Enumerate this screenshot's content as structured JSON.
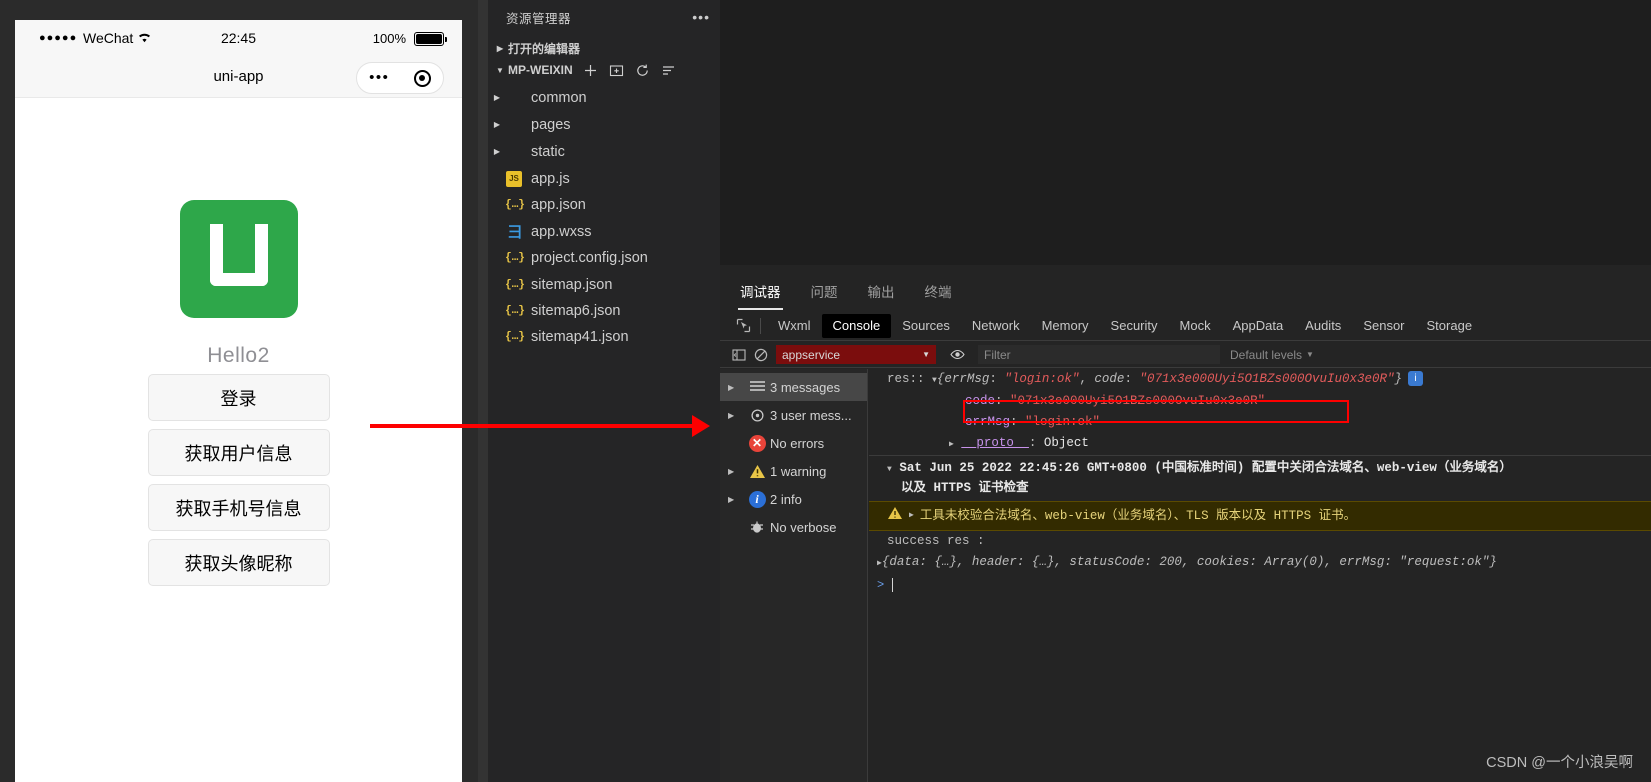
{
  "simulator": {
    "status_bar": {
      "signal_dots": "●●●●●",
      "carrier": "WeChat",
      "wifi_icon": "wifi-icon",
      "time": "22:45",
      "battery_percent": "100%",
      "battery_icon": "battery-full-icon"
    },
    "nav": {
      "title": "uni-app",
      "capsule_more_icon": "•••",
      "capsule_target_icon": "target-icon"
    },
    "app": {
      "logo_icon": "uni-app-logo-icon",
      "logo_color": "#2eA74A",
      "heading": "Hello2",
      "buttons": [
        "登录",
        "获取用户信息",
        "获取手机号信息",
        "获取头像昵称"
      ]
    }
  },
  "explorer": {
    "title": "资源管理器",
    "more_icon": "•••",
    "sections": [
      {
        "label": "打开的编辑器",
        "twisty": "collapsed"
      },
      {
        "label": "MP-WEIXIN",
        "twisty": "expanded"
      }
    ],
    "section_actions": [
      "new-file-icon",
      "new-folder-icon",
      "refresh-icon",
      "collapse-all-icon"
    ],
    "tree": [
      {
        "label": "common",
        "kind": "folder",
        "color": "#6b7a8b",
        "twisty": "collapsed"
      },
      {
        "label": "pages",
        "kind": "folder",
        "color": "#f06a3f",
        "twisty": "collapsed"
      },
      {
        "label": "static",
        "kind": "folder",
        "color": "#e8b62c",
        "twisty": "collapsed"
      },
      {
        "label": "app.js",
        "kind": "js",
        "color": "#e9c02a",
        "tag": "JS"
      },
      {
        "label": "app.json",
        "kind": "json",
        "color": "#e8c547",
        "tag": "{…}"
      },
      {
        "label": "app.wxss",
        "kind": "css",
        "color": "#3b9ae1",
        "tag": "彐"
      },
      {
        "label": "project.config.json",
        "kind": "json",
        "color": "#e8c547",
        "tag": "{…}"
      },
      {
        "label": "sitemap.json",
        "kind": "json",
        "color": "#e8c547",
        "tag": "{…}"
      },
      {
        "label": "sitemap6.json",
        "kind": "json",
        "color": "#e8c547",
        "tag": "{…}"
      },
      {
        "label": "sitemap41.json",
        "kind": "json",
        "color": "#e8c547",
        "tag": "{…}"
      }
    ]
  },
  "devtools": {
    "outer_tabs": [
      {
        "label": "调试器",
        "active": true
      },
      {
        "label": "问题",
        "active": false
      },
      {
        "label": "输出",
        "active": false
      },
      {
        "label": "终端",
        "active": false
      }
    ],
    "inspect_icon": "inspect-element-icon",
    "panel_tabs": [
      {
        "label": "Wxml",
        "active": false
      },
      {
        "label": "Console",
        "active": true
      },
      {
        "label": "Sources",
        "active": false
      },
      {
        "label": "Network",
        "active": false
      },
      {
        "label": "Memory",
        "active": false
      },
      {
        "label": "Security",
        "active": false
      },
      {
        "label": "Mock",
        "active": false
      },
      {
        "label": "AppData",
        "active": false
      },
      {
        "label": "Audits",
        "active": false
      },
      {
        "label": "Sensor",
        "active": false
      },
      {
        "label": "Storage",
        "active": false
      }
    ],
    "console_toolbar": {
      "sidebar_toggle_icon": "console-sidebar-icon",
      "clear_icon": "clear-console-icon",
      "context_value": "appservice",
      "context_bg": "#7b0d0d",
      "eye_icon": "live-expression-icon",
      "filter_placeholder": "Filter",
      "levels_label": "Default levels"
    },
    "counts_sidebar": [
      {
        "label": "3 messages",
        "icon": "list-icon",
        "twisty": true,
        "selected": true
      },
      {
        "label": "3 user mess...",
        "icon": "user-msg-icon",
        "twisty": true,
        "selected": false
      },
      {
        "label": "No errors",
        "icon": "error-icon",
        "twisty": false,
        "selected": false,
        "color": "#e8443a"
      },
      {
        "label": "1 warning",
        "icon": "warning-icon",
        "twisty": true,
        "selected": false,
        "color": "#e8c547"
      },
      {
        "label": "2 info",
        "icon": "info-icon",
        "twisty": true,
        "selected": false,
        "color": "#2b6fd6"
      },
      {
        "label": "No verbose",
        "icon": "verbose-icon",
        "twisty": false,
        "selected": false
      }
    ],
    "console_log": {
      "line1_prefix": "res::",
      "line1_obj_open": "{",
      "line1_k1": "errMsg",
      "line1_v1": "\"login:ok\"",
      "line1_k2": "code",
      "line1_v2": "\"071x3e000Uyi5O1BZs000OvuIu0x3e0R\"",
      "line1_obj_close": "}",
      "line1_info_badge": "i",
      "expanded_code_key": "code",
      "expanded_code_value": "\"071x3e000Uyi5O1BZs000OvuIu0x3e0R\"",
      "expanded_errmsg_key": "errMsg",
      "expanded_errmsg_value": "\"login:ok\"",
      "proto_key": "__proto__",
      "proto_value": "Object",
      "date_line": "Sat Jun 25 2022 22:45:26 GMT+0800 (中国标准时间) 配置中关闭合法域名、web-view（业务域名）",
      "date_line2": "以及 HTTPS 证书检查",
      "warning_icon": "warning-triangle-icon",
      "warning_text": "工具未校验合法域名、web-view（业务域名）、TLS 版本以及 HTTPS 证书。",
      "success_label": "success res :",
      "success_obj": "{data: {…}, header: {…}, statusCode: 200, cookies: Array(0), errMsg: \"request:ok\"}",
      "success_statuscode": "200",
      "prompt_chevron": ">"
    }
  },
  "annotations": {
    "arrow_color": "#fe0000",
    "highlight_box_color": "#fe0000",
    "watermark": "CSDN @一个小浪吴啊"
  }
}
